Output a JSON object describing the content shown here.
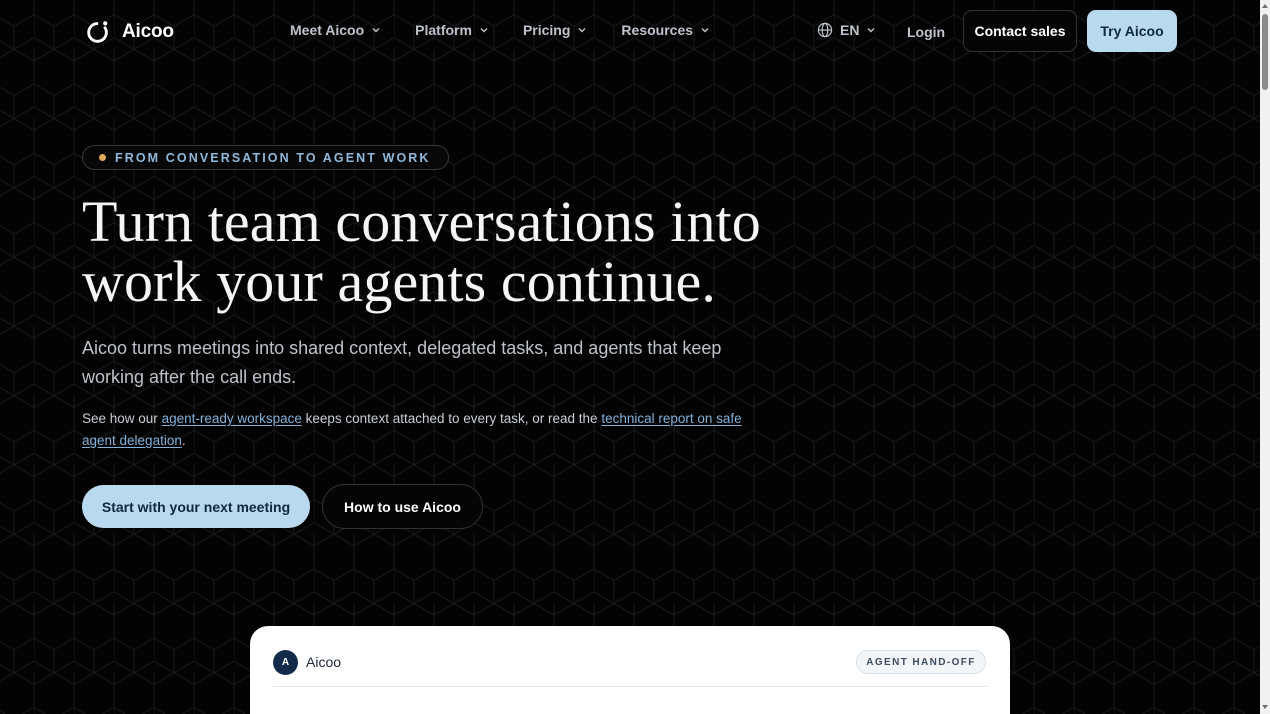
{
  "nav": {
    "logo_text": "Aicoo",
    "items": [
      {
        "label": "Meet Aicoo"
      },
      {
        "label": "Platform"
      },
      {
        "label": "Pricing"
      },
      {
        "label": "Resources"
      }
    ],
    "language": "EN",
    "login": "Login",
    "contact_sales": "Contact sales",
    "try": "Try Aicoo"
  },
  "hero": {
    "eyebrow": "FROM CONVERSATION TO AGENT WORK",
    "headline_line1": "Turn team conversations into",
    "headline_line2": "work your agents continue.",
    "lede": "Aicoo turns meetings into shared context, delegated tasks, and agents that keep working after the call ends.",
    "sub_prefix": "See how our ",
    "sub_link1": "agent-ready workspace",
    "sub_middle": " keeps context attached to every task, or read the ",
    "sub_link2": "technical report on safe agent delegation",
    "sub_suffix": ".",
    "cta_primary": "Start with your next meeting",
    "cta_secondary": "How to use Aicoo"
  },
  "card": {
    "avatar_letter": "A",
    "brand": "Aicoo",
    "badge": "AGENT HAND-OFF"
  },
  "colors": {
    "background": "#030303",
    "accent": "#b9d9ef",
    "accent_text": "#0f2740",
    "eyebrow_text": "#8fb9dc",
    "eyebrow_dot": "#e0a95c",
    "link": "#7fb1da"
  },
  "icons": {
    "logo": "ring-logo-icon",
    "chevron": "chevron-down-icon",
    "language": "globe-icon"
  }
}
